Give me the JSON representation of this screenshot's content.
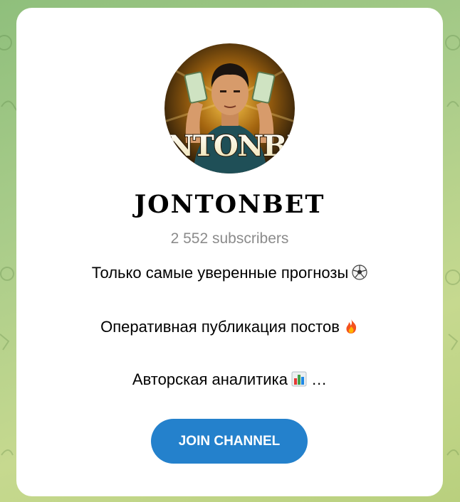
{
  "channel": {
    "avatar_text": "JONTONBET",
    "title": "JONTONBET",
    "subscribers": "2 552 subscribers",
    "description": [
      {
        "text": "Только самые уверенные прогнозы",
        "emoji": "soccer-ball-icon",
        "suffix": ""
      },
      {
        "text": "Оперативная публикация постов",
        "emoji": "fire-icon",
        "suffix": ""
      },
      {
        "text": "Авторская аналитика",
        "emoji": "bar-chart-icon",
        "suffix": "…"
      }
    ],
    "join_label": "JOIN CHANNEL"
  },
  "colors": {
    "accent": "#2481cc",
    "subtitle": "#8b8b8b",
    "background": "#a9cc8a",
    "avatar_gold": "#e8a317",
    "avatar_dark": "#1a1208"
  }
}
